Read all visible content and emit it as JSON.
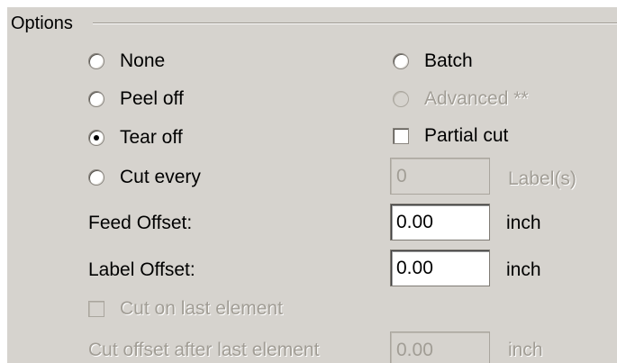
{
  "options": {
    "group_title": "Options",
    "radios": {
      "none": {
        "label": "None",
        "selected": false
      },
      "peel_off": {
        "label": "Peel off",
        "selected": false
      },
      "tear_off": {
        "label": "Tear off",
        "selected": true
      },
      "cut_every": {
        "label": "Cut every",
        "selected": false
      },
      "batch": {
        "label": "Batch",
        "selected": false
      },
      "advanced": {
        "label": "Advanced **",
        "selected": false,
        "disabled": true
      }
    },
    "partial_cut": {
      "label": "Partial cut",
      "checked": false
    },
    "cut_every_count": {
      "value": "0",
      "unit": "Label(s)",
      "disabled": true
    },
    "feed_offset": {
      "label": "Feed Offset:",
      "value": "0.00",
      "unit": "inch"
    },
    "label_offset": {
      "label": "Label Offset:",
      "value": "0.00",
      "unit": "inch"
    },
    "cut_on_last_element": {
      "label": "Cut on last element",
      "checked": false,
      "disabled": true
    },
    "cut_offset_after_last": {
      "label": "Cut offset after last element",
      "value": "0.00",
      "unit": "inch",
      "disabled": true
    }
  }
}
